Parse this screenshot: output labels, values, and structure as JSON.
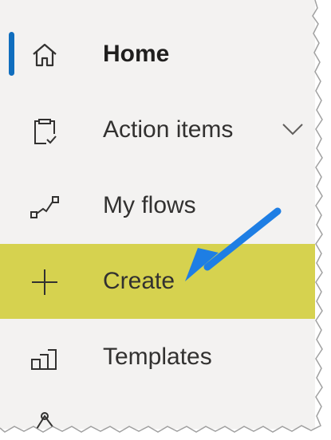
{
  "nav": {
    "items": [
      {
        "label": "Home",
        "icon": "home-icon",
        "active": true
      },
      {
        "label": "Action items",
        "icon": "clipboard-check-icon",
        "expandable": true
      },
      {
        "label": "My flows",
        "icon": "flow-icon"
      },
      {
        "label": "Create",
        "icon": "plus-icon",
        "highlighted": true
      },
      {
        "label": "Templates",
        "icon": "templates-icon"
      }
    ]
  },
  "colors": {
    "highlight": "#d6d24f",
    "active_indicator": "#106ebe",
    "annotation_arrow": "#1e7ee4",
    "panel_background": "#f3f2f1"
  }
}
